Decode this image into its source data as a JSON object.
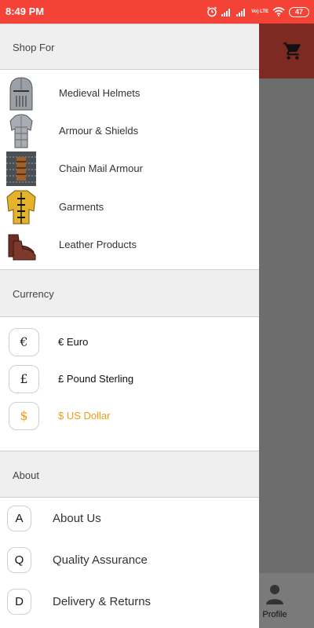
{
  "status_bar": {
    "time": "8:49 PM",
    "network_label": "Vo) LTE",
    "battery": "47"
  },
  "app": {
    "cart_icon": "cart-icon",
    "bottom_nav": {
      "profile_label": "Profile"
    }
  },
  "drawer": {
    "shop": {
      "header": "Shop For",
      "items": [
        {
          "label": "Medieval Helmets",
          "icon": "helmet"
        },
        {
          "label": "Armour & Shields",
          "icon": "armour"
        },
        {
          "label": "Chain Mail Armour",
          "icon": "chainmail"
        },
        {
          "label": "Garments",
          "icon": "garment"
        },
        {
          "label": "Leather Products",
          "icon": "leather-boots"
        }
      ]
    },
    "currency": {
      "header": "Currency",
      "items": [
        {
          "symbol": "€",
          "label": "€ Euro",
          "selected": false
        },
        {
          "symbol": "£",
          "label": "£ Pound Sterling",
          "selected": false
        },
        {
          "symbol": "$",
          "label": "$ US Dollar",
          "selected": true
        }
      ],
      "selected_color": "#f39c12"
    },
    "about": {
      "header": "About",
      "items": [
        {
          "letter": "A",
          "label": "About Us"
        },
        {
          "letter": "Q",
          "label": "Quality Assurance"
        },
        {
          "letter": "D",
          "label": "Delivery & Returns"
        }
      ]
    }
  },
  "colors": {
    "status_bar": "#f44336",
    "app_header": "#7d2a22",
    "scrim": "#6d6d6d",
    "section_header_bg": "#efefef"
  }
}
